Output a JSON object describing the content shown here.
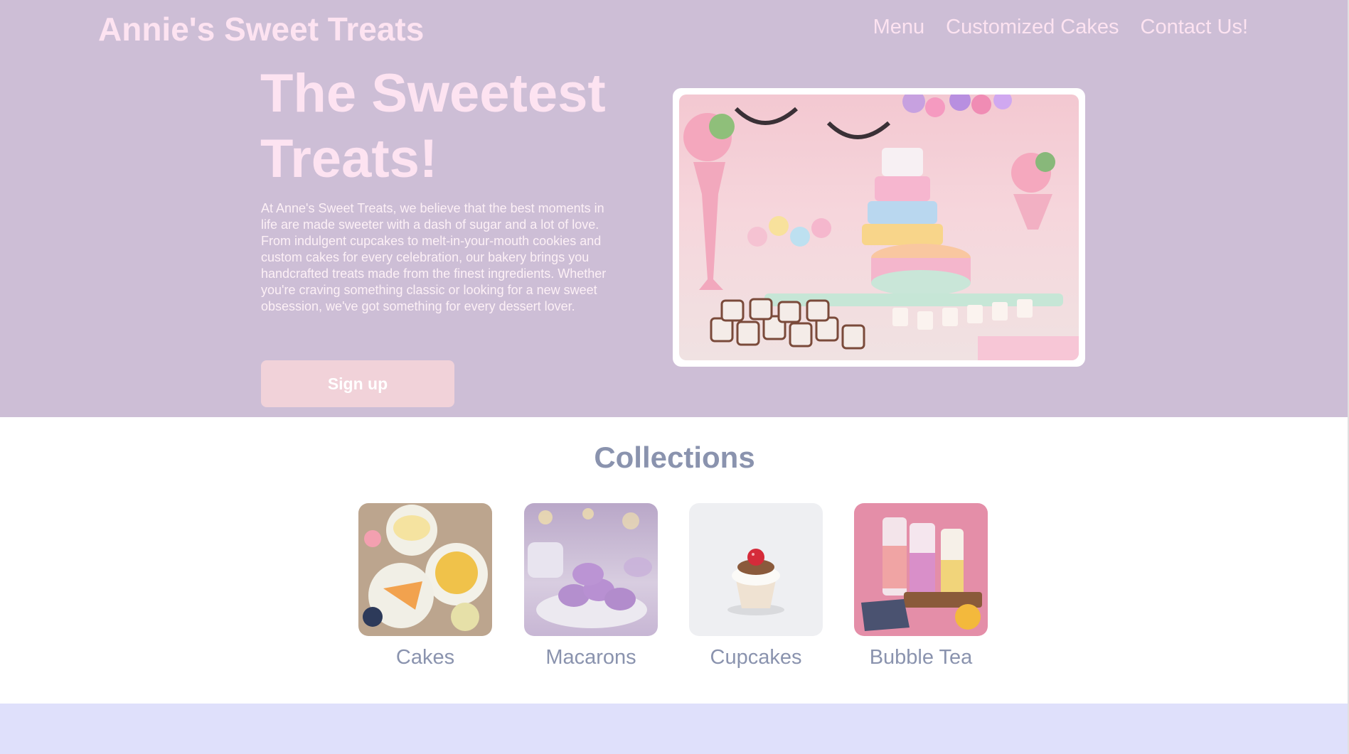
{
  "header": {
    "brand": "Annie's Sweet Treats",
    "nav": [
      "Menu",
      "Customized Cakes",
      "Contact Us!"
    ]
  },
  "hero": {
    "title": "The Sweetest Treats!",
    "description": "At Anne's Sweet Treats, we believe that the best moments in life are made sweeter with a dash of sugar and a lot of love. From indulgent cupcakes to melt-in-your-mouth cookies and custom cakes for every celebration, our bakery brings you handcrafted treats made from the finest ingredients. Whether you're craving something classic or looking for a new sweet obsession, we've got something for every dessert lover.",
    "cta_label": "Sign up"
  },
  "collections": {
    "title": "Collections",
    "items": [
      {
        "label": "Cakes"
      },
      {
        "label": "Macarons"
      },
      {
        "label": "Cupcakes"
      },
      {
        "label": "Bubble Tea"
      }
    ]
  },
  "colors": {
    "hero_bg": "#cdbed6",
    "accent_pink": "#fde3f1",
    "button_bg": "#f1d2d9",
    "heading_gray": "#8a93ae",
    "footer_bg": "#dfe0fb"
  }
}
